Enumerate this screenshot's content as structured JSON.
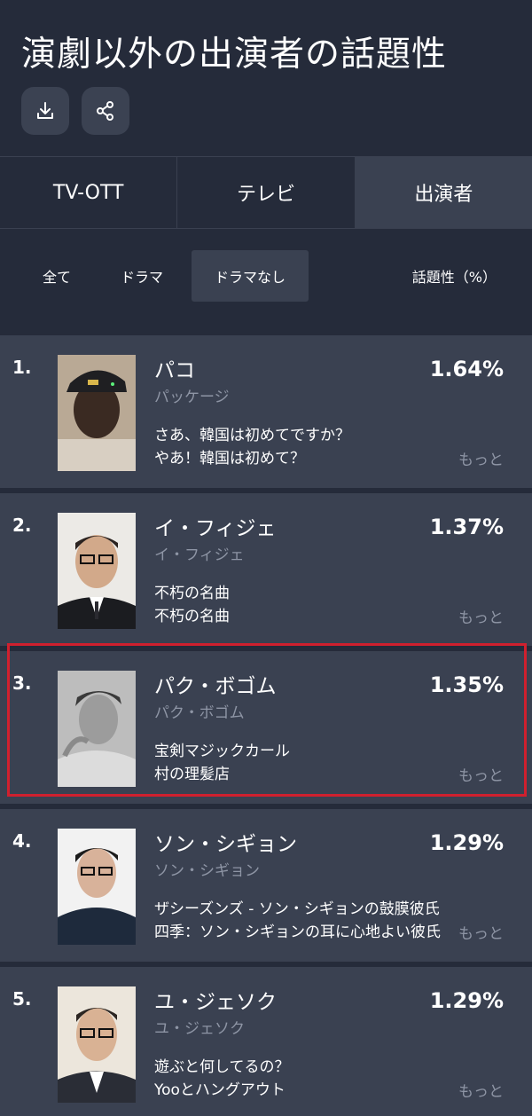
{
  "header": {
    "title": "演劇以外の出演者の話題性",
    "download_icon": "download-icon",
    "share_icon": "share-icon"
  },
  "main_tabs": [
    {
      "label": "TV-OTT",
      "active": false
    },
    {
      "label": "テレビ",
      "active": false
    },
    {
      "label": "出演者",
      "active": true
    }
  ],
  "filters": [
    {
      "label": "全て",
      "active": false
    },
    {
      "label": "ドラマ",
      "active": false
    },
    {
      "label": "ドラマなし",
      "active": true
    }
  ],
  "metric_label": "話題性（%）",
  "items": [
    {
      "rank": "1.",
      "name": "パコ",
      "subname": "パッケージ",
      "works": [
        "さあ、韓国は初めてですか？",
        "やあ！韓国は初めて？"
      ],
      "percent": "1.64%",
      "more": "もっと"
    },
    {
      "rank": "2.",
      "name": "イ・フィジェ",
      "subname": "イ・フィジェ",
      "works": [
        "不朽の名曲",
        "不朽の名曲"
      ],
      "percent": "1.37%",
      "more": "もっと"
    },
    {
      "rank": "3.",
      "name": "パク・ボゴム",
      "subname": "パク・ボゴム",
      "works": [
        "宝剣マジックカール",
        "村の理髪店"
      ],
      "percent": "1.35%",
      "more": "もっと"
    },
    {
      "rank": "4.",
      "name": "ソン・シギョン",
      "subname": "ソン・シギョン",
      "works": [
        "ザシーズンズ - ソン・シギョンの鼓膜彼氏",
        "四季：ソン・シギョンの耳に心地よい彼氏"
      ],
      "percent": "1.29%",
      "more": "もっと"
    },
    {
      "rank": "5.",
      "name": "ユ・ジェソク",
      "subname": "ユ・ジェソク",
      "works": [
        "遊ぶと何してるの？",
        "Yooとハングアウト"
      ],
      "percent": "1.29%",
      "more": "もっと"
    }
  ],
  "colors": {
    "background": "#252b3a",
    "card": "#3a4151",
    "muted_text": "#8e95a5",
    "highlight_border": "#d0202e"
  }
}
